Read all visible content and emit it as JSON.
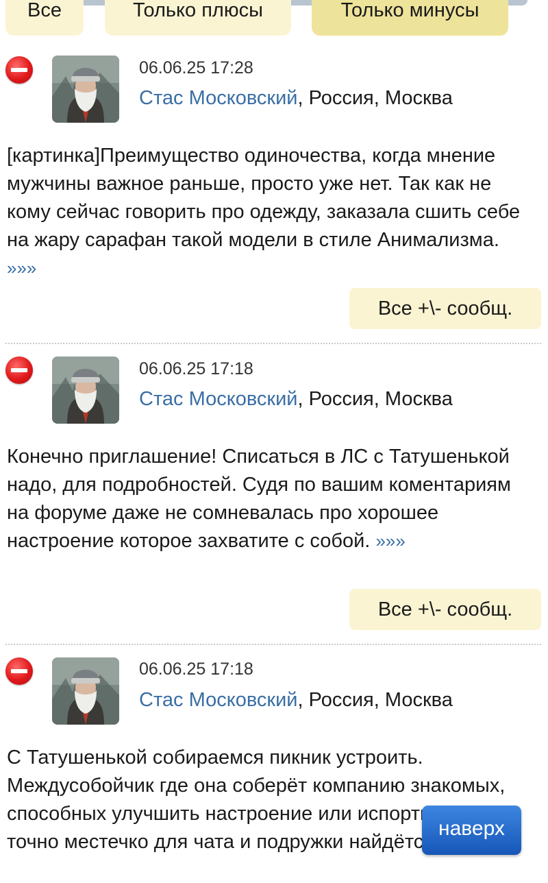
{
  "filters": {
    "all": "Все",
    "plus_only": "Только плюсы",
    "minus_only": "Только минусы"
  },
  "posts": [
    {
      "timestamp": "06.06.25 17:28",
      "author": "Стас Московский",
      "location": ", Россия, Москва",
      "text": "[картинка]Преимущество одиночества, когда мнение мужчины важное раньше, просто уже нет. Так как не кому сейчас говорить про одежду, заказала сшить себе на жару сарафан такой модели в стиле Анимализма.",
      "more": "»»»",
      "all_messages": "Все +\\- сообщ."
    },
    {
      "timestamp": "06.06.25 17:18",
      "author": "Стас Московский",
      "location": ", Россия, Москва",
      "text": "Конечно приглашение! Списаться в ЛС с Татушенькой надо, для подробностей. Судя по вашим коментариям на форуме даже не сомневалась про хорошее настроение которое захватите с собой.",
      "more": "»»»",
      "all_messages": "Все +\\- сообщ."
    },
    {
      "timestamp": "06.06.25 17:18",
      "author": "Стас Московский",
      "location": ", Россия, Москва",
      "text": "С Татушенькой собираемся пикник устроить. Междусобойчик где она соберёт компанию знакомых, способных улучшить настроение или испортить, и уж точно местечко для чата и подружки найдётся.",
      "more": "»»»"
    }
  ],
  "to_top_label": "наверх",
  "icons": {
    "rating": "minus-icon",
    "avatar": "avatar-image"
  },
  "colors": {
    "link": "#3a6ea5",
    "button_bg": "#fbf4d3",
    "active_filter_bg": "#eee39a",
    "to_top_bg": "#1f63c8",
    "minus_red": "#e0191b"
  }
}
